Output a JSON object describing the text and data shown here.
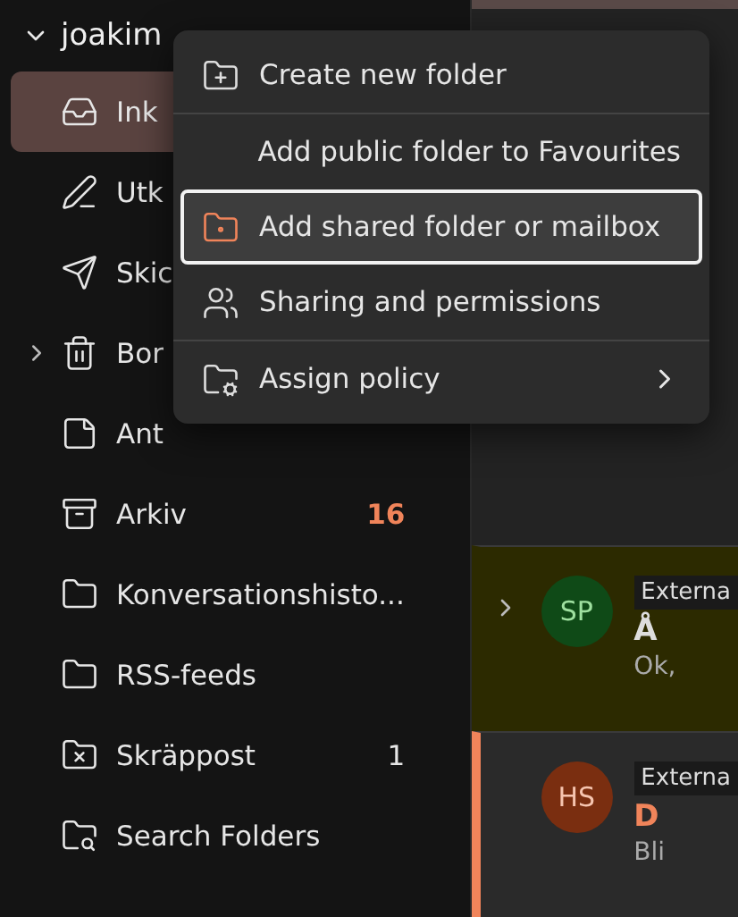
{
  "account": {
    "name": "joakim",
    "expanded": true
  },
  "folders": [
    {
      "label": "Ink",
      "selected": true,
      "expandable": false
    },
    {
      "label": "Utk",
      "selected": false,
      "expandable": false
    },
    {
      "label": "Skic",
      "selected": false,
      "expandable": false
    },
    {
      "label": "Bor",
      "selected": false,
      "expandable": true
    },
    {
      "label": "Ant",
      "selected": false,
      "expandable": false
    },
    {
      "label": "Arkiv",
      "selected": false,
      "expandable": false,
      "count": "16",
      "highlight": true
    },
    {
      "label": "Konversationshisto...",
      "selected": false,
      "expandable": false
    },
    {
      "label": "RSS-feeds",
      "selected": false,
      "expandable": false
    },
    {
      "label": "Skräppost",
      "selected": false,
      "expandable": false,
      "count": "1",
      "highlight": false
    },
    {
      "label": "Search Folders",
      "selected": false,
      "expandable": false
    }
  ],
  "messages": [
    {
      "initials": "SP",
      "color": "#0f4a17",
      "tag": "Externa",
      "subject": "Å",
      "preview": "Ok,",
      "expandable": true,
      "flagged": true,
      "unread": false
    },
    {
      "initials": "HS",
      "color": "#7a2e10",
      "tag": "Externa",
      "subject": "D",
      "preview": "Bli",
      "expandable": false,
      "flagged": false,
      "unread": true
    }
  ],
  "context_menu": {
    "items": [
      {
        "kind": "item",
        "label": "Create new folder",
        "selected": false,
        "submenu": false
      },
      {
        "kind": "divider"
      },
      {
        "kind": "item",
        "label": "Add public folder to Favourites",
        "selected": false,
        "submenu": false
      },
      {
        "kind": "item",
        "label": "Add shared folder or mailbox",
        "selected": true,
        "submenu": false
      },
      {
        "kind": "item",
        "label": "Sharing and permissions",
        "selected": false,
        "submenu": false
      },
      {
        "kind": "divider"
      },
      {
        "kind": "item",
        "label": "Assign policy",
        "selected": false,
        "submenu": true
      }
    ]
  }
}
